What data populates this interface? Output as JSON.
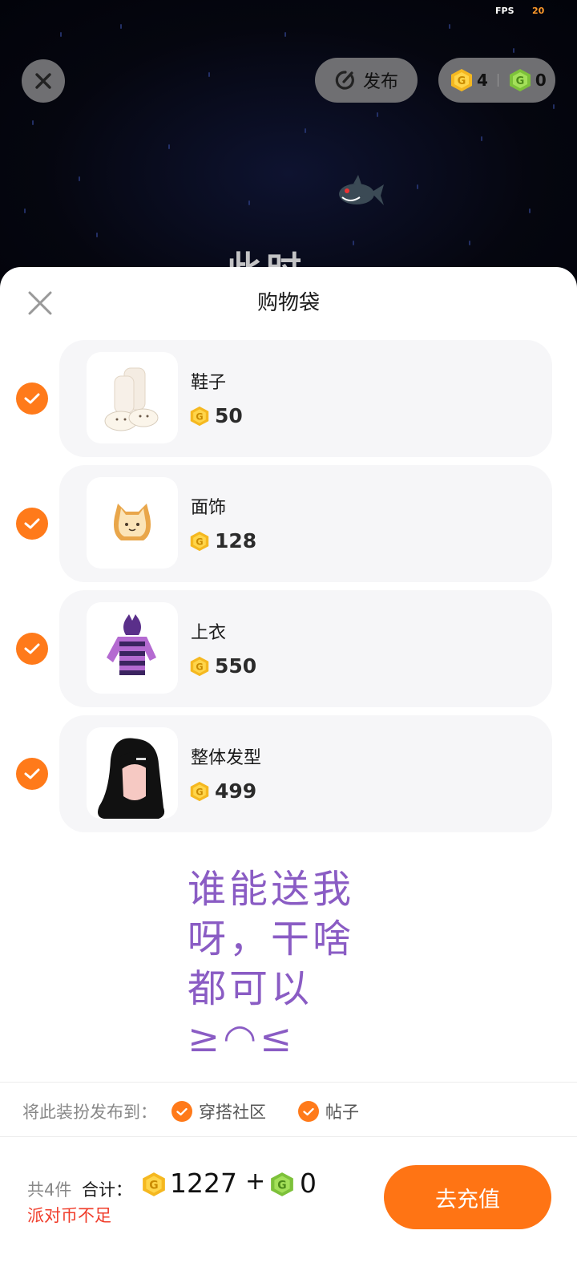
{
  "status": {
    "fps_label": "FPS",
    "fps_value": "20"
  },
  "top_bar": {
    "publish_label": "发布",
    "gold_coins": "4",
    "green_coins": "0"
  },
  "background_text": "此时",
  "sheet": {
    "title": "购物袋",
    "items": [
      {
        "name": "鞋子",
        "price": "50",
        "icon": "shoes-thumbnail"
      },
      {
        "name": "面饰",
        "price": "128",
        "icon": "cat-toast-thumbnail"
      },
      {
        "name": "上衣",
        "price": "550",
        "icon": "striped-hoodie-thumbnail"
      },
      {
        "name": "整体发型",
        "price": "499",
        "icon": "black-hair-thumbnail"
      }
    ]
  },
  "sticker_text": [
    "谁能送我",
    "呀，干啥",
    "都可以 ≥◠≤"
  ],
  "publish_to": {
    "label": "将此装扮发布到：",
    "options": [
      "穿搭社区",
      "帖子"
    ]
  },
  "footer": {
    "count_label": "共4件",
    "total_label": "合计：",
    "gold_total": "1227",
    "plus": "+",
    "green_total": "0",
    "warning": "派对币不足",
    "recharge_label": "去充值"
  },
  "colors": {
    "accent": "#ff7414",
    "warning": "#f03c2a",
    "gold_coin": "#f5b820",
    "green_coin": "#7dc13a"
  }
}
